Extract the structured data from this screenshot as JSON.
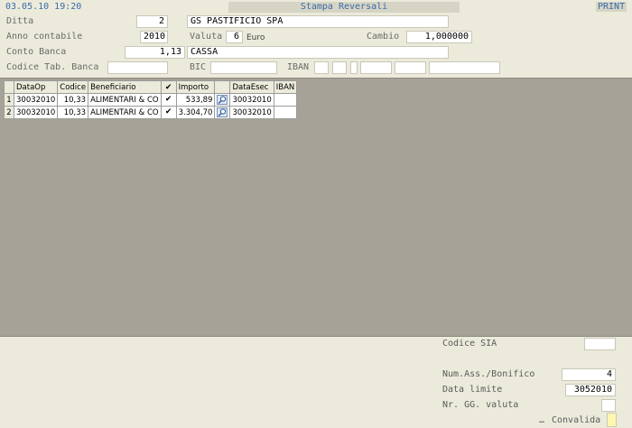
{
  "header": {
    "datetime": "03.05.10 19:20",
    "title": "Stampa Reversali",
    "print_label": "PRINT"
  },
  "form": {
    "ditta_label": "Ditta",
    "ditta_value": "2",
    "ditta_name": "GS PASTIFICIO SPA",
    "anno_label": "Anno contabile",
    "anno_value": "2010",
    "valuta_label": "Valuta",
    "valuta_code": "6",
    "valuta_name": "Euro",
    "cambio_label": "Cambio",
    "cambio_value": "1,000000",
    "conto_label": "Conto Banca",
    "conto_value": "1,13",
    "conto_name": "CASSA",
    "codice_tab_label": "Codice Tab. Banca",
    "codice_tab_value": "",
    "bic_label": "BIC",
    "bic_value": "",
    "iban_label": "IBAN"
  },
  "grid": {
    "columns": [
      "DataOp",
      "Codice",
      "Beneficiario",
      "✔",
      "Importo",
      "",
      "DataEsec",
      "IBAN"
    ],
    "rows": [
      {
        "n": "1",
        "dataop": "30032010",
        "codice": "10,33",
        "beneficiario": "ALIMENTARI & CO",
        "check": "✔",
        "importo": "533,89",
        "dataesec": "30032010",
        "iban": ""
      },
      {
        "n": "2",
        "dataop": "30032010",
        "codice": "10,33",
        "beneficiario": "ALIMENTARI & CO",
        "check": "✔",
        "importo": "3.304,70",
        "dataesec": "30032010",
        "iban": ""
      }
    ]
  },
  "footer": {
    "codice_sia_label": "Codice SIA",
    "codice_sia_value": "",
    "num_ass_label": "Num.Ass./Bonifico",
    "num_ass_value": "4",
    "data_limite_label": "Data limite",
    "data_limite_value": "3052010",
    "nr_gg_label": "Nr. GG. valuta",
    "nr_gg_value": "",
    "convalida_label": "Convalida"
  },
  "colors": {
    "accent": "#3a6aa8",
    "background": "#ecebdb",
    "grid_area": "#a7a297",
    "convalida_box": "#fff7b0"
  }
}
